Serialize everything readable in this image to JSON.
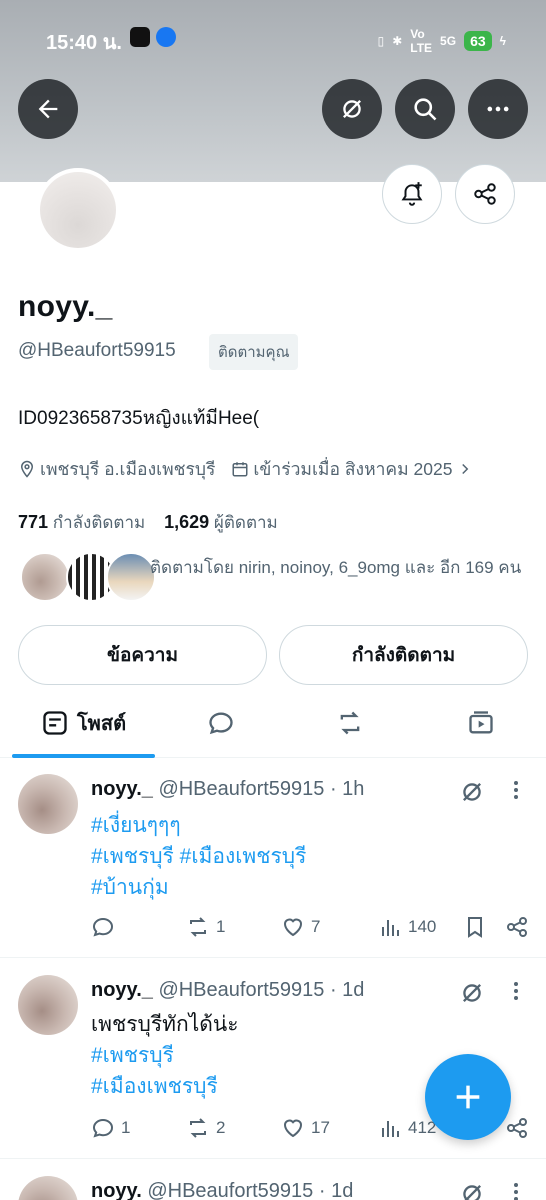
{
  "status_bar": {
    "time": "15:40 น.",
    "battery": "63",
    "network": "5G"
  },
  "profile": {
    "name": "noyy._",
    "handle": "@HBeaufort59915",
    "follows_you": "ติดตามคุณ",
    "bio": "ID0923658735หญิงแท้มีHee(",
    "location": "เพชรบุรี อ.เมืองเพชรบุรี",
    "joined": "เข้าร่วมเมื่อ สิงหาคม 2025",
    "following_count": "771",
    "following_label": "กำลังติดตาม",
    "followers_count": "1,629",
    "followers_label": "ผู้ติดตาม",
    "followed_by": "ติดตามโดย nirin, noinoy, 6_9omg และ อีก 169 คน"
  },
  "buttons": {
    "message": "ข้อความ",
    "following": "กำลังติดตาม"
  },
  "tabs": {
    "posts": "โพสต์"
  },
  "posts": [
    {
      "name": "noyy._",
      "handle_time": "@HBeaufort59915 · 1h",
      "lines": [
        "#เงี่ยนๆๆๆ",
        "#เพชรบุรี #เมืองเพชรบุรี",
        "#บ้านกุ่ม"
      ],
      "replies": "",
      "reposts": "1",
      "likes": "7",
      "views": "140"
    },
    {
      "name": "noyy._",
      "handle_time": "@HBeaufort59915 · 1d",
      "lines": [
        "เพชรบุรีทักได้น่ะ",
        "#เพชรบุรี",
        "#เมืองเพชรบุรี"
      ],
      "replies": "1",
      "reposts": "2",
      "likes": "17",
      "views": "412"
    },
    {
      "name": "noyy.",
      "handle_time": "@HBeaufort59915 · 1d"
    }
  ]
}
